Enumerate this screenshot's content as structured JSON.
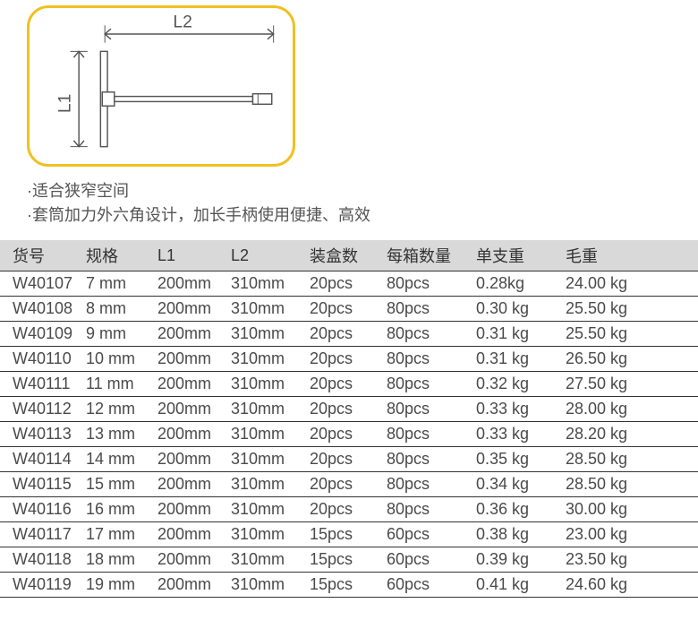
{
  "diagram": {
    "label_l1": "L1",
    "label_l2": "L2"
  },
  "features": [
    "·适合狭窄空间",
    "·套筒加力外六角设计，加长手柄使用便捷、高效"
  ],
  "table": {
    "headers": [
      "货号",
      "规格",
      "L1",
      "L2",
      "装盒数",
      "每箱数量",
      "单支重",
      "毛重"
    ],
    "rows": [
      [
        "W40107",
        "7 mm",
        "200mm",
        "310mm",
        "20pcs",
        "80pcs",
        "0.28kg",
        "24.00 kg"
      ],
      [
        "W40108",
        "8 mm",
        "200mm",
        "310mm",
        "20pcs",
        "80pcs",
        "0.30 kg",
        "25.50 kg"
      ],
      [
        "W40109",
        "9 mm",
        "200mm",
        "310mm",
        "20pcs",
        "80pcs",
        "0.31 kg",
        "25.50 kg"
      ],
      [
        "W40110",
        "10 mm",
        "200mm",
        "310mm",
        "20pcs",
        "80pcs",
        "0.31 kg",
        "26.50 kg"
      ],
      [
        "W40111",
        "11 mm",
        "200mm",
        "310mm",
        "20pcs",
        "80pcs",
        "0.32 kg",
        "27.50 kg"
      ],
      [
        "W40112",
        "12 mm",
        "200mm",
        "310mm",
        "20pcs",
        "80pcs",
        "0.33 kg",
        "28.00 kg"
      ],
      [
        "W40113",
        "13 mm",
        "200mm",
        "310mm",
        "20pcs",
        "80pcs",
        "0.33 kg",
        "28.20 kg"
      ],
      [
        "W40114",
        "14 mm",
        "200mm",
        "310mm",
        "20pcs",
        "80pcs",
        "0.35 kg",
        "28.50 kg"
      ],
      [
        "W40115",
        "15 mm",
        "200mm",
        "310mm",
        "20pcs",
        "80pcs",
        "0.34 kg",
        "28.50 kg"
      ],
      [
        "W40116",
        "16 mm",
        "200mm",
        "310mm",
        "20pcs",
        "80pcs",
        "0.36 kg",
        "30.00 kg"
      ],
      [
        "W40117",
        "17 mm",
        "200mm",
        "310mm",
        "15pcs",
        "60pcs",
        "0.38 kg",
        "23.00 kg"
      ],
      [
        "W40118",
        "18 mm",
        "200mm",
        "310mm",
        "15pcs",
        "60pcs",
        "0.39 kg",
        "23.50 kg"
      ],
      [
        "W40119",
        "19 mm",
        "200mm",
        "310mm",
        "15pcs",
        "60pcs",
        "0.41 kg",
        "24.60 kg"
      ]
    ]
  }
}
